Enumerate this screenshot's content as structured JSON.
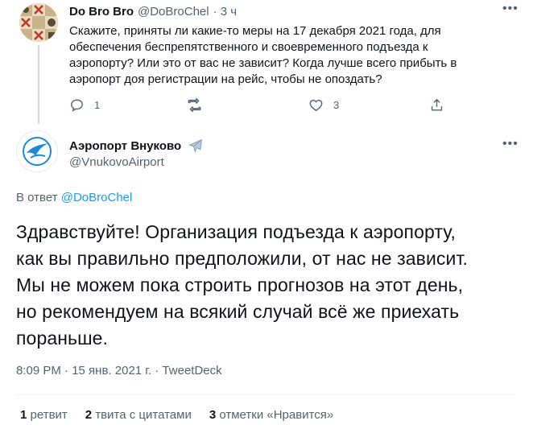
{
  "parent_tweet": {
    "author_name": "Do Bro Bro",
    "author_handle": "@DoBroChel",
    "time": "· 3 ч",
    "text_lines": [
      "Скажите, приняты ли какие-то меры на 17 декабря 2021 года, для",
      "обеспечения беспрепятственного и своевременного подъезда к",
      "аэропорту? Или это от вас не зависит? Когда лучше всего прибыть в",
      "аэропорт доя регистрации на рейс, чтобы не опоздать?"
    ],
    "reply_count": "1",
    "like_count": "3"
  },
  "main_tweet": {
    "author_name": "Аэропорт Внуково",
    "author_handle": "@VnukovoAirport",
    "reply_prefix": "В ответ",
    "reply_to": "@DoBroChel",
    "text_lines": [
      "Здравствуйте! Организация подъезда к аэропорту,",
      "как вы правильно предположили, от нас не зависит.",
      "Мы не можем пока строить прогнозов на этот день,",
      "но рекомендуем на всякий случай всё же приехать",
      "пораньше."
    ],
    "timestamp": "8:09 PM · 15 янв. 2021 г. · TweetDeck",
    "stats": {
      "retweets_count": "1",
      "retweets_label": "ретвит",
      "quotes_count": "2",
      "quotes_label": "твита с цитатами",
      "likes_count": "3",
      "likes_label": "отметки «Нравится»"
    }
  },
  "icons": {
    "more": "more-icon",
    "reply": "reply-icon",
    "retweet": "retweet-icon",
    "like": "like-icon",
    "share": "share-icon",
    "airplane": "airplane-emoji-icon"
  },
  "colors": {
    "accent": "#1d9bf0",
    "muted": "#536471",
    "text": "#0f1419"
  }
}
